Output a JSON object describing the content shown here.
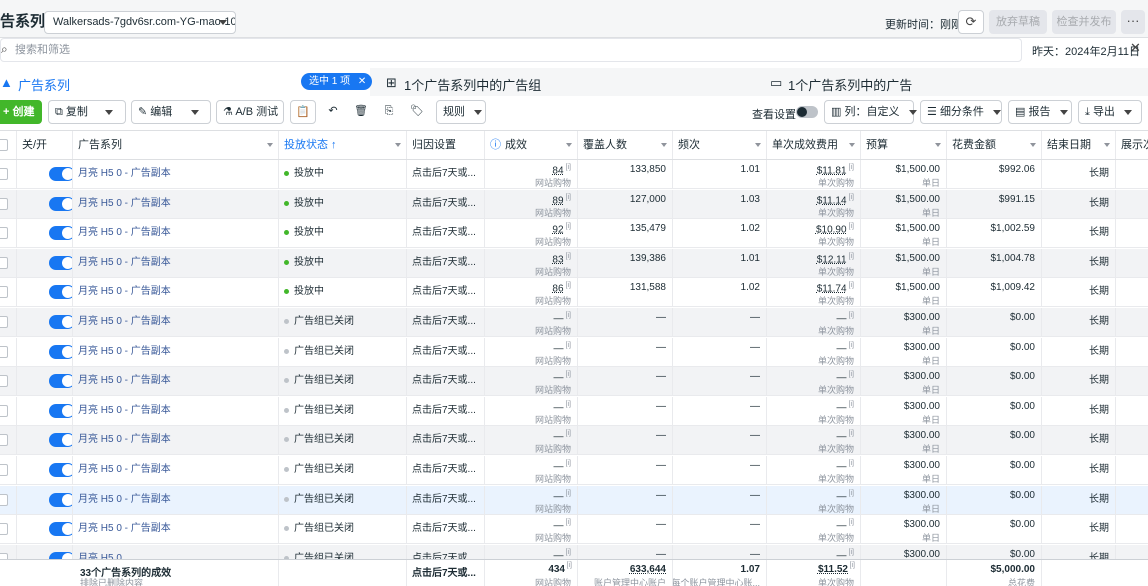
{
  "header": {
    "title": "告系列",
    "account": "Walkersads-7gdv6sr.com-YG-mao-10...",
    "updated": "更新时间：刚刚",
    "discard_label": "放弃草稿",
    "review_label": "检查并发布",
    "more_label": "···"
  },
  "search": {
    "placeholder": "搜索和筛选",
    "date_range": "昨天：2024年2月11日",
    "close": "✕"
  },
  "tabs": {
    "campaigns": "广告系列",
    "selected": "选中 1 项",
    "adsets": "1个广告系列中的广告组",
    "ads": "1个广告系列中的广告"
  },
  "toolbar": {
    "create": "创建",
    "duplicate": "复制",
    "edit": "编辑",
    "ab_test": "A/B 测试",
    "rules": "规则",
    "view_settings": "查看设置",
    "columns": "列：自定义",
    "breakdown": "细分条件",
    "reports": "报告",
    "export": "导出"
  },
  "columns": [
    "关/开",
    "广告系列",
    "投放状态 ↑",
    "归因设置",
    "成效",
    "覆盖人数",
    "频次",
    "单次成效费用",
    "预算",
    "花费金额",
    "结束日期",
    "展示次"
  ],
  "rows": [
    {
      "name": "月亮 H5 0 - 广告副本",
      "status": "投放中",
      "active": true,
      "attr": "点击后7天或...",
      "results": "84",
      "results_sub": "网站购物",
      "reach": "133,850",
      "freq": "1.01",
      "cpr": "$11.81",
      "cpr_sub": "单次购物",
      "budget": "$1,500.00",
      "budget_sub": "单日",
      "spend": "$992.06",
      "end": "长期"
    },
    {
      "name": "月亮 H5 0 - 广告副本",
      "status": "投放中",
      "active": true,
      "attr": "点击后7天或...",
      "results": "89",
      "results_sub": "网站购物",
      "reach": "127,000",
      "freq": "1.03",
      "cpr": "$11.14",
      "cpr_sub": "单次购物",
      "budget": "$1,500.00",
      "budget_sub": "单日",
      "spend": "$991.15",
      "end": "长期"
    },
    {
      "name": "月亮 H5 0 - 广告副本",
      "status": "投放中",
      "active": true,
      "attr": "点击后7天或...",
      "results": "92",
      "results_sub": "网站购物",
      "reach": "135,479",
      "freq": "1.02",
      "cpr": "$10.90",
      "cpr_sub": "单次购物",
      "budget": "$1,500.00",
      "budget_sub": "单日",
      "spend": "$1,002.59",
      "end": "长期"
    },
    {
      "name": "月亮 H5 0 - 广告副本",
      "status": "投放中",
      "active": true,
      "attr": "点击后7天或...",
      "results": "83",
      "results_sub": "网站购物",
      "reach": "139,386",
      "freq": "1.01",
      "cpr": "$12.11",
      "cpr_sub": "单次购物",
      "budget": "$1,500.00",
      "budget_sub": "单日",
      "spend": "$1,004.78",
      "end": "长期"
    },
    {
      "name": "月亮 H5 0 - 广告副本",
      "status": "投放中",
      "active": true,
      "attr": "点击后7天或...",
      "results": "86",
      "results_sub": "网站购物",
      "reach": "131,588",
      "freq": "1.02",
      "cpr": "$11.74",
      "cpr_sub": "单次购物",
      "budget": "$1,500.00",
      "budget_sub": "单日",
      "spend": "$1,009.42",
      "end": "长期"
    },
    {
      "name": "月亮 H5 0 - 广告副本",
      "status": "广告组已关闭",
      "active": false,
      "attr": "点击后7天或...",
      "results": "—",
      "results_sub": "网站购物",
      "reach": "—",
      "freq": "—",
      "cpr": "—",
      "cpr_sub": "单次购物",
      "budget": "$300.00",
      "budget_sub": "单日",
      "spend": "$0.00",
      "end": "长期"
    },
    {
      "name": "月亮 H5 0 - 广告副本",
      "status": "广告组已关闭",
      "active": false,
      "attr": "点击后7天或...",
      "results": "—",
      "results_sub": "网站购物",
      "reach": "—",
      "freq": "—",
      "cpr": "—",
      "cpr_sub": "单次购物",
      "budget": "$300.00",
      "budget_sub": "单日",
      "spend": "$0.00",
      "end": "长期"
    },
    {
      "name": "月亮 H5 0 - 广告副本",
      "status": "广告组已关闭",
      "active": false,
      "attr": "点击后7天或...",
      "results": "—",
      "results_sub": "网站购物",
      "reach": "—",
      "freq": "—",
      "cpr": "—",
      "cpr_sub": "单次购物",
      "budget": "$300.00",
      "budget_sub": "单日",
      "spend": "$0.00",
      "end": "长期"
    },
    {
      "name": "月亮 H5 0 - 广告副本",
      "status": "广告组已关闭",
      "active": false,
      "attr": "点击后7天或...",
      "results": "—",
      "results_sub": "网站购物",
      "reach": "—",
      "freq": "—",
      "cpr": "—",
      "cpr_sub": "单次购物",
      "budget": "$300.00",
      "budget_sub": "单日",
      "spend": "$0.00",
      "end": "长期"
    },
    {
      "name": "月亮 H5 0 - 广告副本",
      "status": "广告组已关闭",
      "active": false,
      "attr": "点击后7天或...",
      "results": "—",
      "results_sub": "网站购物",
      "reach": "—",
      "freq": "—",
      "cpr": "—",
      "cpr_sub": "单次购物",
      "budget": "$300.00",
      "budget_sub": "单日",
      "spend": "$0.00",
      "end": "长期"
    },
    {
      "name": "月亮 H5 0 - 广告副本",
      "status": "广告组已关闭",
      "active": false,
      "attr": "点击后7天或...",
      "results": "—",
      "results_sub": "网站购物",
      "reach": "—",
      "freq": "—",
      "cpr": "—",
      "cpr_sub": "单次购物",
      "budget": "$300.00",
      "budget_sub": "单日",
      "spend": "$0.00",
      "end": "长期"
    },
    {
      "name": "月亮 H5 0 - 广告副本",
      "status": "广告组已关闭",
      "active": false,
      "attr": "点击后7天或...",
      "results": "—",
      "results_sub": "网站购物",
      "reach": "—",
      "freq": "—",
      "cpr": "—",
      "cpr_sub": "单次购物",
      "budget": "$300.00",
      "budget_sub": "单日",
      "spend": "$0.00",
      "end": "长期"
    },
    {
      "name": "月亮 H5 0 - 广告副本",
      "status": "广告组已关闭",
      "active": false,
      "attr": "点击后7天或...",
      "results": "—",
      "results_sub": "网站购物",
      "reach": "—",
      "freq": "—",
      "cpr": "—",
      "cpr_sub": "单次购物",
      "budget": "$300.00",
      "budget_sub": "单日",
      "spend": "$0.00",
      "end": "长期"
    },
    {
      "name": "月亮 H5 0",
      "status": "广告组已关闭",
      "active": false,
      "attr": "点击后7天或...",
      "results": "—",
      "results_sub": "网站购物",
      "reach": "—",
      "freq": "—",
      "cpr": "—",
      "cpr_sub": "单次购物",
      "budget": "$300.00",
      "budget_sub": "单日",
      "spend": "$0.00",
      "end": "长期"
    },
    {
      "name": "月亮 H5 0 - 广告副本",
      "status": "广告组已关闭",
      "active": false,
      "attr": "点击后7天或...",
      "results": "—",
      "results_sub": "网站购物",
      "reach": "—",
      "freq": "—",
      "cpr": "—",
      "cpr_sub": "单次购物",
      "budget": "$1,500.00",
      "budget_sub": "单日",
      "spend": "$0.00",
      "end": "长期"
    }
  ],
  "footer": {
    "label": "33个广告系列的成效",
    "label_sub": "排除已删除内容",
    "attr": "点击后7天或...",
    "results": "434",
    "results_sub": "网站购物",
    "reach": "633,644",
    "reach_sub": "账户管理中心账户",
    "freq": "1.07",
    "freq_sub": "每个账户管理中心账...",
    "cpr": "$11.52",
    "cpr_sub": "单次购物",
    "spend": "$5,000.00",
    "spend_sub": "总花费"
  },
  "colors": {
    "accent": "#1877f2",
    "active_dot": "#42b72a",
    "link": "#385898"
  }
}
